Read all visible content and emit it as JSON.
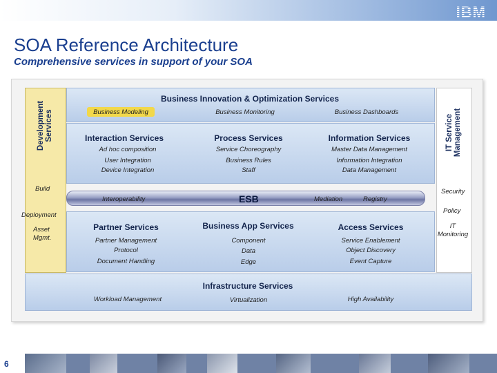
{
  "header": {
    "logo_text": "IBM",
    "title": "SOA Reference Architecture",
    "subtitle": "Comprehensive services in support of your SOA"
  },
  "diagram": {
    "business_innovation": {
      "title": "Business Innovation & Optimization Services",
      "items": [
        "Business Modeling",
        "Business Monitoring",
        "Business Dashboards"
      ]
    },
    "development_services": {
      "label": "Development Services",
      "items": [
        "Build",
        "Deployment",
        "Asset Mgmt."
      ]
    },
    "it_service_management": {
      "label": "IT Service Management",
      "items": [
        "Security",
        "Policy",
        "IT Monitoring"
      ]
    },
    "upper_services": [
      {
        "title": "Interaction Services",
        "items": [
          "Ad hoc composition",
          "User Integration",
          "Device Integration"
        ]
      },
      {
        "title": "Process Services",
        "items": [
          "Service Choreography",
          "Business Rules",
          "Staff"
        ]
      },
      {
        "title": "Information Services",
        "items": [
          "Master Data Management",
          "Information Integration",
          "Data Management"
        ]
      }
    ],
    "esb": {
      "label": "ESB",
      "left_items": [
        "Interoperability"
      ],
      "right_items": [
        "Mediation",
        "Registry"
      ]
    },
    "lower_services": [
      {
        "title": "Partner Services",
        "items": [
          "Partner Management",
          "Protocol",
          "Document Handling"
        ]
      },
      {
        "title": "Business App Services",
        "items": [
          "Component",
          "Data",
          "Edge"
        ]
      },
      {
        "title": "Access Services",
        "items": [
          "Service Enablement",
          "Object Discovery",
          "Event Capture"
        ]
      }
    ],
    "infrastructure": {
      "title": "Infrastructure Services",
      "items": [
        "Workload Management",
        "Virtualization",
        "High Availability"
      ]
    }
  },
  "footer": {
    "page_number": "6"
  },
  "colors": {
    "title_blue": "#1a3f8f",
    "panel_blue": "#c7d7ee",
    "dev_yellow": "#f6e9a8",
    "highlight_yellow": "#f2d84a",
    "bottom_bar": "#6f82a5"
  }
}
